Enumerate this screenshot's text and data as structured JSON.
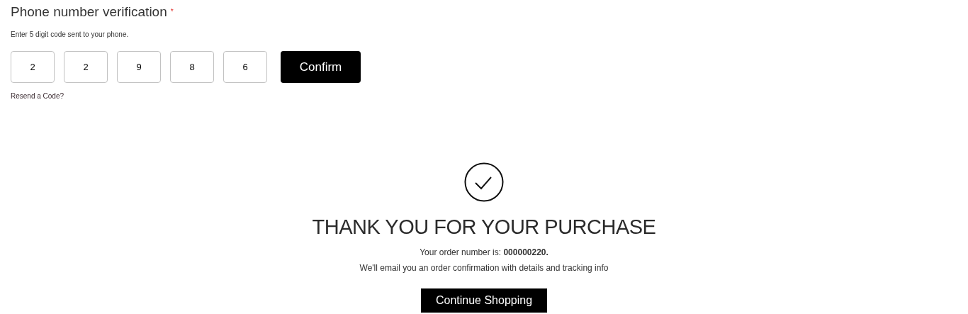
{
  "verification": {
    "title": "Phone number verification",
    "required_mark": "*",
    "hint": "Enter 5 digit code sent to your phone.",
    "digits": [
      "2",
      "2",
      "9",
      "8",
      "6"
    ],
    "confirm_button": "Confirm",
    "resend_link": "Resend a Code?"
  },
  "confirmation": {
    "heading": "THANK YOU FOR YOUR PURCHASE",
    "order_line": "Your order number is: **000000220.**",
    "email_line": "We'll email you an order confirmation with details and tracking info",
    "continue_button": "Continue Shopping"
  }
}
